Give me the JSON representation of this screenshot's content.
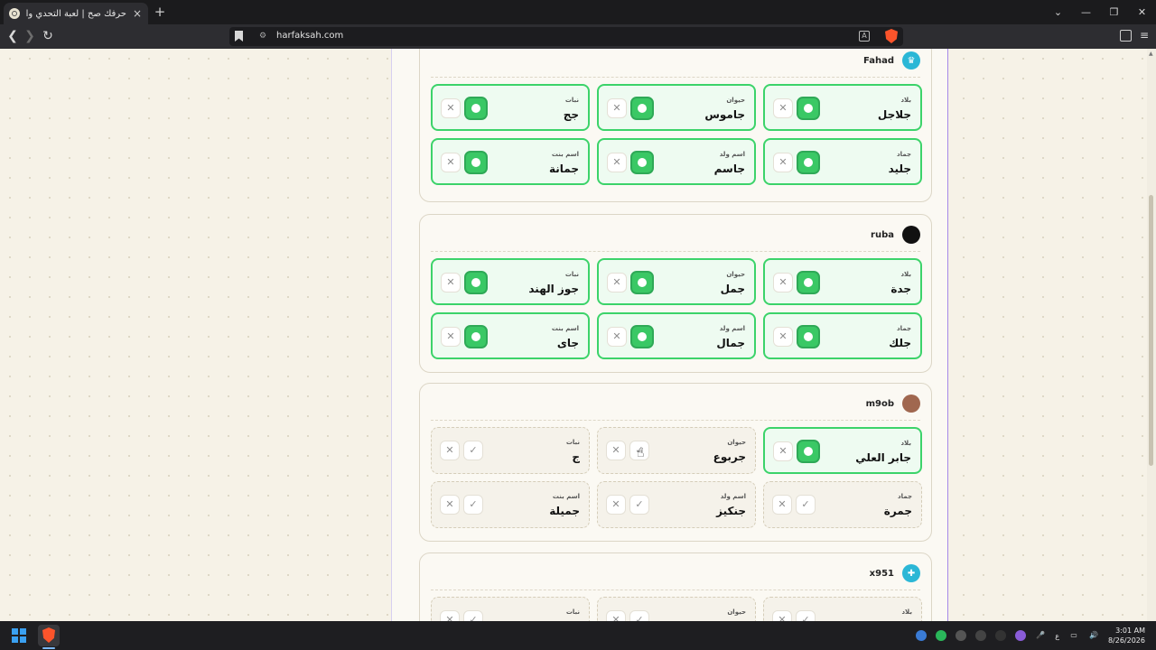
{
  "browser": {
    "tab_title": "حرفك صح | لعبة التحدي والكلمات",
    "tab_close": "×",
    "new_tab": "+",
    "url": "harfaksah.com",
    "window_controls": [
      "⌄",
      "—",
      "❐",
      "✕"
    ]
  },
  "players": [
    {
      "name": "Fahad",
      "avatar_icon": "crown-icon",
      "avatar_color": "#2bb7d6",
      "answers": [
        {
          "category": "بلاد",
          "word": "جلاجل",
          "status": "accepted"
        },
        {
          "category": "حيوان",
          "word": "جاموس",
          "status": "accepted"
        },
        {
          "category": "نبات",
          "word": "جج",
          "status": "accepted"
        },
        {
          "category": "جماد",
          "word": "جليد",
          "status": "accepted"
        },
        {
          "category": "اسم ولد",
          "word": "جاسم",
          "status": "accepted"
        },
        {
          "category": "اسم بنت",
          "word": "جمانة",
          "status": "accepted"
        }
      ]
    },
    {
      "name": "ruba",
      "avatar_icon": "dark-avatar-icon",
      "avatar_color": "#111111",
      "answers": [
        {
          "category": "بلاد",
          "word": "جدة",
          "status": "accepted"
        },
        {
          "category": "حيوان",
          "word": "جمل",
          "status": "accepted"
        },
        {
          "category": "نبات",
          "word": "جوز الهند",
          "status": "accepted"
        },
        {
          "category": "جماد",
          "word": "جلك",
          "status": "accepted"
        },
        {
          "category": "اسم ولد",
          "word": "جمال",
          "status": "accepted"
        },
        {
          "category": "اسم بنت",
          "word": "جاى",
          "status": "accepted"
        }
      ]
    },
    {
      "name": "m9ob",
      "avatar_icon": "photo-avatar-icon",
      "avatar_color": "#a0674f",
      "answers": [
        {
          "category": "بلاد",
          "word": "جابر العلي",
          "status": "accepted"
        },
        {
          "category": "حيوان",
          "word": "جربوع",
          "status": "pending"
        },
        {
          "category": "نبات",
          "word": "ج",
          "status": "pending"
        },
        {
          "category": "جماد",
          "word": "جمرة",
          "status": "pending"
        },
        {
          "category": "اسم ولد",
          "word": "جنكيز",
          "status": "pending"
        },
        {
          "category": "اسم بنت",
          "word": "جميلة",
          "status": "pending"
        }
      ]
    },
    {
      "name": "x951",
      "avatar_icon": "user-add-icon",
      "avatar_color": "#2bb7d6",
      "answers": [
        {
          "category": "بلاد",
          "word": "",
          "status": "pending"
        },
        {
          "category": "حيوان",
          "word": "",
          "status": "pending"
        },
        {
          "category": "نبات",
          "word": "",
          "status": "pending"
        }
      ]
    }
  ],
  "buttons": {
    "reject_glyph": "✕",
    "accept_glyph": "✓"
  },
  "taskbar": {
    "keyboard_lang": "ع",
    "time": "3:01 AM",
    "date": "8/26/2026"
  }
}
